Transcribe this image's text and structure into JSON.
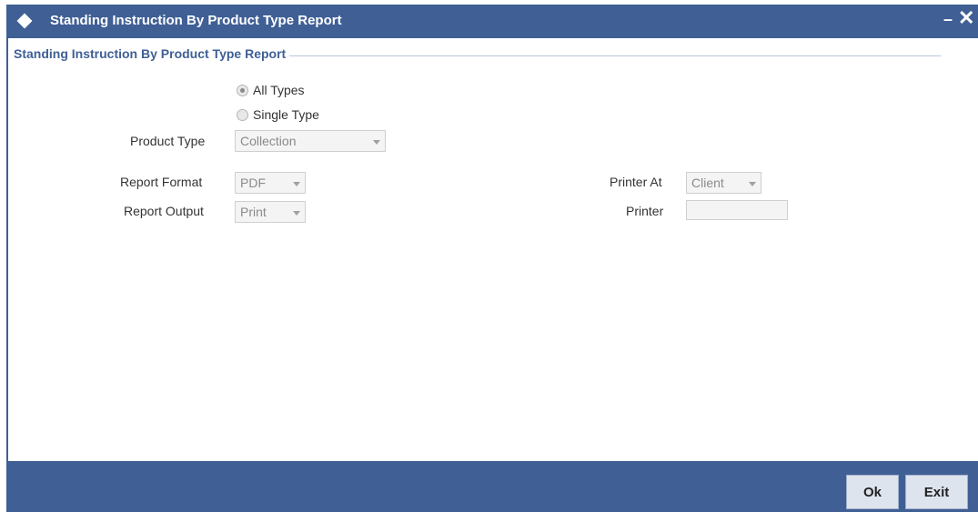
{
  "window": {
    "title": "Standing Instruction By Product Type Report",
    "minimize_glyph": "–",
    "close_glyph": "✕"
  },
  "section": {
    "legend": "Standing Instruction By Product Type Report"
  },
  "type_selection": {
    "all_types_label": "All Types",
    "single_type_label": "Single Type",
    "selected": "All Types"
  },
  "fields": {
    "product_type_label": "Product Type",
    "product_type_value": "Collection",
    "report_format_label": "Report Format",
    "report_format_value": "PDF",
    "report_output_label": "Report Output",
    "report_output_value": "Print",
    "printer_at_label": "Printer At",
    "printer_at_value": "Client",
    "printer_label": "Printer",
    "printer_value": ""
  },
  "footer": {
    "ok_label": "Ok",
    "exit_label": "Exit"
  },
  "colors": {
    "titlebar": "#3f5f95",
    "section_legend": "#3f5f95",
    "button_bg": "#dde4ee"
  },
  "icons": {
    "title_icon": "diamond-icon",
    "dropdown_icon": "chevron-down-icon"
  }
}
